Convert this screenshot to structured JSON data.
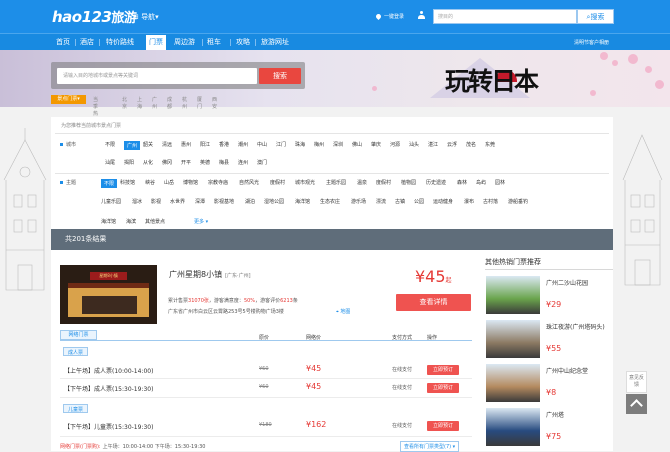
{
  "header": {
    "logo": "hao123",
    "logo_suffix": "旅游",
    "nav_select": "导航",
    "location_label": "一键登录",
    "search_placeholder": "搜目的",
    "search_button": "搜索"
  },
  "nav": {
    "items": [
      {
        "label": "首页"
      },
      {
        "label": "酒店"
      },
      {
        "label": "特价路线"
      },
      {
        "label": "门票"
      },
      {
        "label": "周边游"
      },
      {
        "label": "租车"
      },
      {
        "label": "攻略"
      },
      {
        "label": "旅游网址"
      }
    ],
    "active_index": 3,
    "right_link": "清明节客户相册"
  },
  "banner": {
    "search_placeholder": "请输入目的地城市或景点等关键词",
    "search_button": "搜索",
    "brand_text": "玩转日本",
    "tags": [
      "景点门票",
      "当季热门",
      "北京",
      "上海",
      "广州",
      "成都",
      "杭州",
      "厦门",
      "西安"
    ]
  },
  "filter": {
    "hint": "为您推荐当前城市景点门票",
    "city_label": "城市",
    "cities_row1": [
      "不限",
      "广州",
      "韶关",
      "清远",
      "惠州",
      "阳江",
      "香港",
      "潮州",
      "中山",
      "江门",
      "珠海",
      "梅州",
      "深圳",
      "佛山",
      "肇庆",
      "河源",
      "汕头",
      "湛江",
      "云浮",
      "茂名",
      "东莞"
    ],
    "cities_row2": [
      "汕尾",
      "揭阳",
      "从化",
      "佛冈",
      "开平",
      "英德",
      "梅县",
      "连州",
      "澳门"
    ],
    "active_city": "广州",
    "theme_label": "主题",
    "themes_row1": [
      "不限",
      "科技馆",
      "峡谷",
      "山岳",
      "博物馆",
      "宗教寺庙",
      "自然风光",
      "度假村",
      "城市观光",
      "主题乐园",
      "温泉",
      "度假村",
      "植物园",
      "历史遗迹",
      "森林",
      "岛屿",
      "园林"
    ],
    "themes_row2": [
      "儿童乐园",
      "溜冰",
      "影视",
      "水世界",
      "深潭",
      "影视基地",
      "湖泊",
      "湿地公园",
      "海洋馆",
      "生态农庄",
      "游乐场",
      "漂流",
      "古镇",
      "公园",
      "运动健身",
      "瀑布",
      "古村落",
      "游船垂钓"
    ],
    "themes_row3": [
      "海洋馆",
      "海滨",
      "其他景点"
    ],
    "active_theme": "不限",
    "more": "更多"
  },
  "results": {
    "count_text": "共201条结果"
  },
  "product": {
    "image_sign": "星期8小镇",
    "name": "广州星期8小镇",
    "region": "[广东·广州]",
    "stat_prefix": "累计售票",
    "sold": "31070张",
    "stat_mid": "，游客满意度：",
    "satisfaction": "50%",
    "stat_mid2": "，游客评价",
    "reviews": "6213",
    "stat_suffix": "条",
    "address": "广东省广州市白云区云霄路253号5号楼购物广场3楼",
    "map_link": "地图",
    "price": "¥45",
    "price_suffix": "起",
    "detail_button": "查看详情",
    "table_tab": "网络门票",
    "columns": [
      "原价",
      "网络价",
      "支付方式",
      "操作"
    ],
    "groups": [
      {
        "tag": "成人票",
        "rows": [
          {
            "name": "【上午场】成人票(10:00-14:00)",
            "original": "¥60",
            "price": "¥45",
            "pay": "在线支付",
            "action": "立即预订"
          },
          {
            "name": "【下午场】成人票(15:30-19:30)",
            "original": "¥60",
            "price": "¥45",
            "pay": "在线支付",
            "action": "立即预订"
          }
        ]
      },
      {
        "tag": "儿童票",
        "rows": [
          {
            "name": "【下午场】儿童票(15:30-19:30)",
            "original": "¥180",
            "price": "¥162",
            "pay": "在线支付",
            "action": "立即预订"
          }
        ]
      }
    ],
    "footer_label": "网络门票(门票购):",
    "footer_text": "上午场：10:00-14:00 下午场：15:30-19:30",
    "more_types": "查看所有门票类型(7)"
  },
  "sidebar": {
    "title": "其他热销门票推荐",
    "items": [
      {
        "name": "广州二沙山花园",
        "price": "¥29",
        "color": "#6aa44c"
      },
      {
        "name": "珠江夜游(广州塔码头)",
        "price": "¥55",
        "color": "#8c7a63"
      },
      {
        "name": "广州中山纪念堂",
        "price": "¥8",
        "color": "#b48a5f"
      },
      {
        "name": "广州塔",
        "price": "¥75",
        "color": "#284b80"
      }
    ]
  },
  "widgets": {
    "feedback": "意见反馈"
  }
}
